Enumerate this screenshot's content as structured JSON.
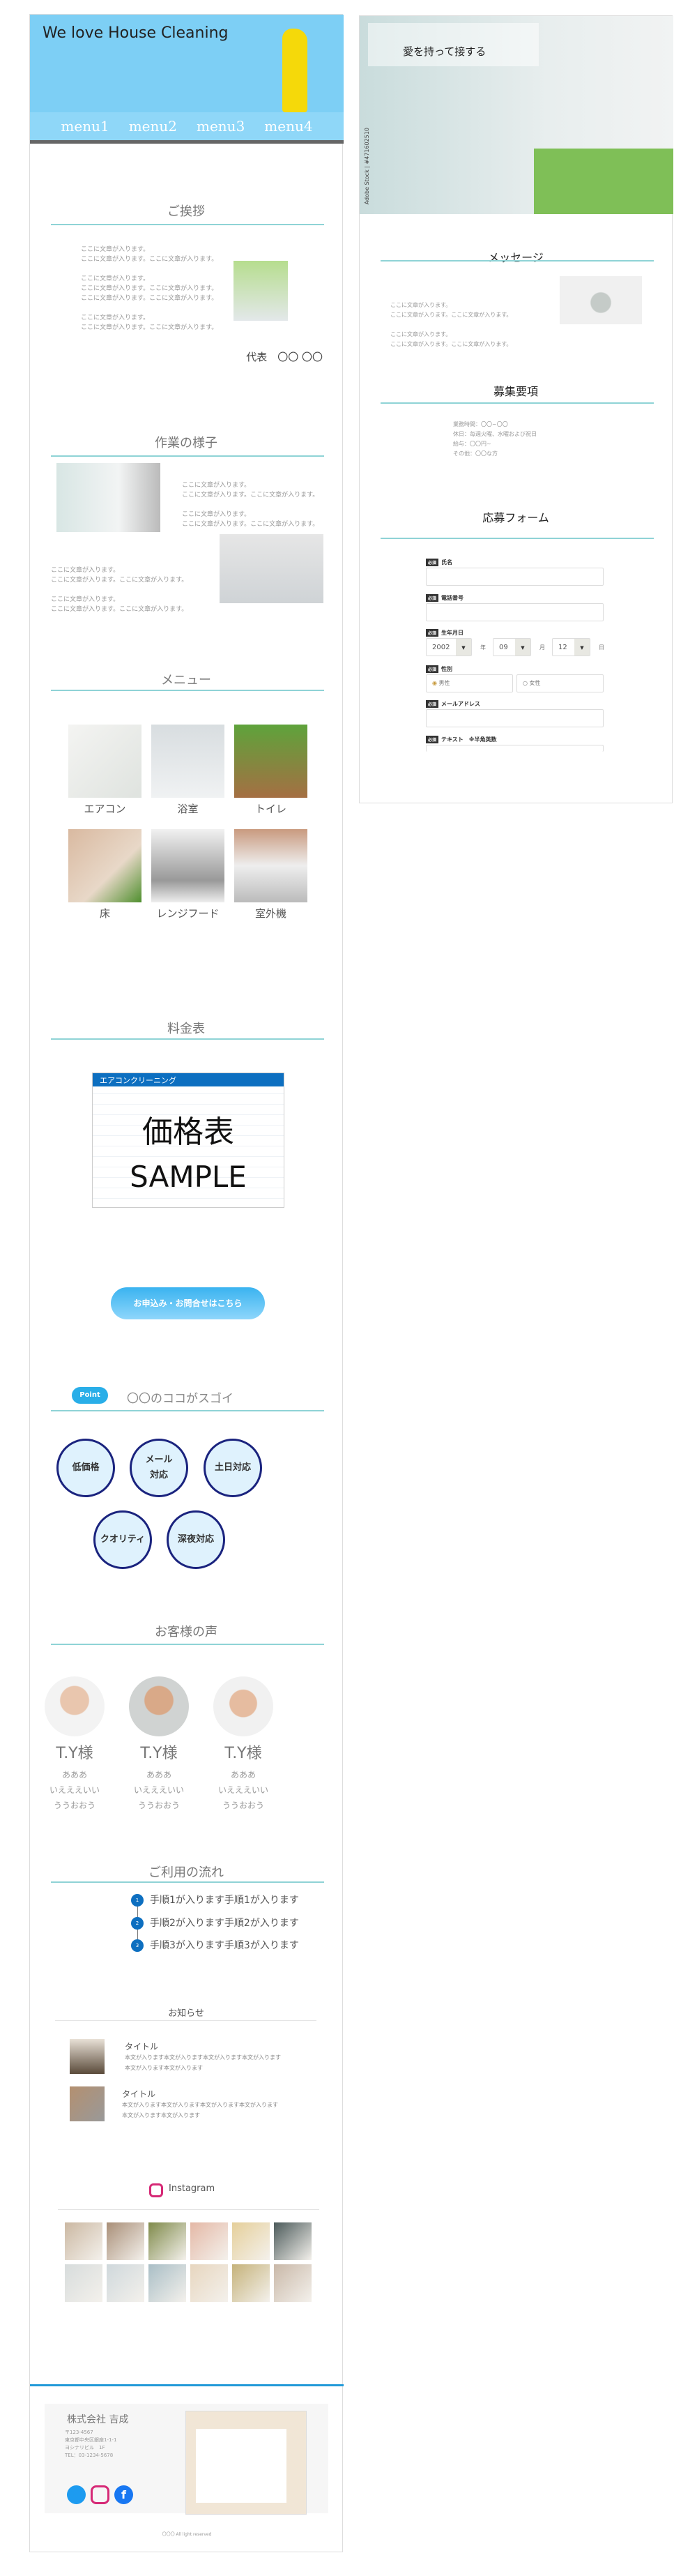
{
  "header": {
    "title": "We love House Cleaning",
    "menu": [
      "menu1",
      "menu2",
      "menu3",
      "menu4"
    ]
  },
  "greeting": {
    "heading": "ご挨拶",
    "paragraphs": [
      "ここに文章が入ります。\nここに文章が入ります。ここに文章が入ります。",
      "ここに文章が入ります。\nここに文章が入ります。ここに文章が入ります。\nここに文章が入ります。ここに文章が入ります。",
      "ここに文章が入ります。\nここに文章が入ります。ここに文章が入ります。"
    ],
    "signature": "代表　〇〇 〇〇"
  },
  "work": {
    "heading": "作業の様子",
    "text1": "ここに文章が入ります。\nここに文章が入ります。ここに文章が入ります。\n\nここに文章が入ります。\nここに文章が入ります。ここに文章が入ります。",
    "text2": "ここに文章が入ります。\nここに文章が入ります。ここに文章が入ります。\n\nここに文章が入ります。\nここに文章が入ります。ここに文章が入ります。"
  },
  "menu": {
    "heading": "メニュー",
    "items": [
      "エアコン",
      "浴室",
      "トイレ",
      "床",
      "レンジフード",
      "室外機"
    ]
  },
  "price": {
    "heading": "料金表",
    "card_title": "エアコンクリーニング",
    "overlay1": "価格表",
    "overlay2": "SAMPLE"
  },
  "cta": {
    "label": "お申込み・お問合せはこちら"
  },
  "points": {
    "badge": "Point",
    "heading": "〇〇のココがスゴイ",
    "items": [
      "低価格",
      "メール\n対応",
      "土日対応",
      "クオリティ",
      "深夜対応"
    ]
  },
  "voices": {
    "heading": "お客様の声",
    "items": [
      {
        "name": "T.Y様",
        "text": "あああ\nいえええいい\nううおおう"
      },
      {
        "name": "T.Y様",
        "text": "あああ\nいえええいい\nううおおう"
      },
      {
        "name": "T.Y様",
        "text": "あああ\nいえええいい\nううおおう"
      }
    ]
  },
  "flow": {
    "heading": "ご利用の流れ",
    "steps": [
      {
        "n": "1",
        "text": "手順1が入ります手順1が入ります"
      },
      {
        "n": "2",
        "text": "手順2が入ります手順2が入ります"
      },
      {
        "n": "3",
        "text": "手順3が入ります手順3が入ります"
      }
    ]
  },
  "news": {
    "heading": "お知らせ",
    "items": [
      {
        "title": "タイトル",
        "body": "本文が入ります本文が入ります本文が入ります本文が入ります\n本文が入ります本文が入ります"
      },
      {
        "title": "タイトル",
        "body": "本文が入ります本文が入ります本文が入ります本文が入ります\n本文が入ります本文が入ります"
      }
    ]
  },
  "instagram": {
    "heading": "Instagram"
  },
  "footer": {
    "company": "株式会社 吉成",
    "address": "〒123-4567\n東京都中央区銀座1-1-1\nヨシナリビル　1F\nTEL：03-1234-5678",
    "copyright": "〇〇〇 All light reserved"
  },
  "recruit": {
    "hero_title": "愛を持って接する",
    "watermark": "Adobe Stock | #471602510",
    "message_heading": "メッセージ",
    "message_text": "ここに文章が入ります。\nここに文章が入ります。ここに文章が入ります。\n\nここに文章が入ります。\nここに文章が入ります。ここに文章が入ります。",
    "requirements_heading": "募集要項",
    "requirements": "業務時間：〇〇~〇〇\n休日：毎週火曜、水曜および祝日\n給与：〇〇円~\nその他：〇〇な方",
    "form_heading": "応募フォーム",
    "required": "必須",
    "form": {
      "name": "氏名",
      "phone": "電話番号",
      "birth": "生年月日",
      "year": "2002",
      "year_unit": "年",
      "month": "09",
      "month_unit": "月",
      "day": "12",
      "day_unit": "日",
      "gender": "性別",
      "male": "男性",
      "female": "女性",
      "email": "メールアドレス",
      "text": "テキスト　※半角英数"
    }
  },
  "colors": {
    "header_bg": "#7dcff5",
    "accent_line": "#8fd3d6",
    "circle_border": "#1a237e",
    "step_blue": "#0d6fc0"
  }
}
